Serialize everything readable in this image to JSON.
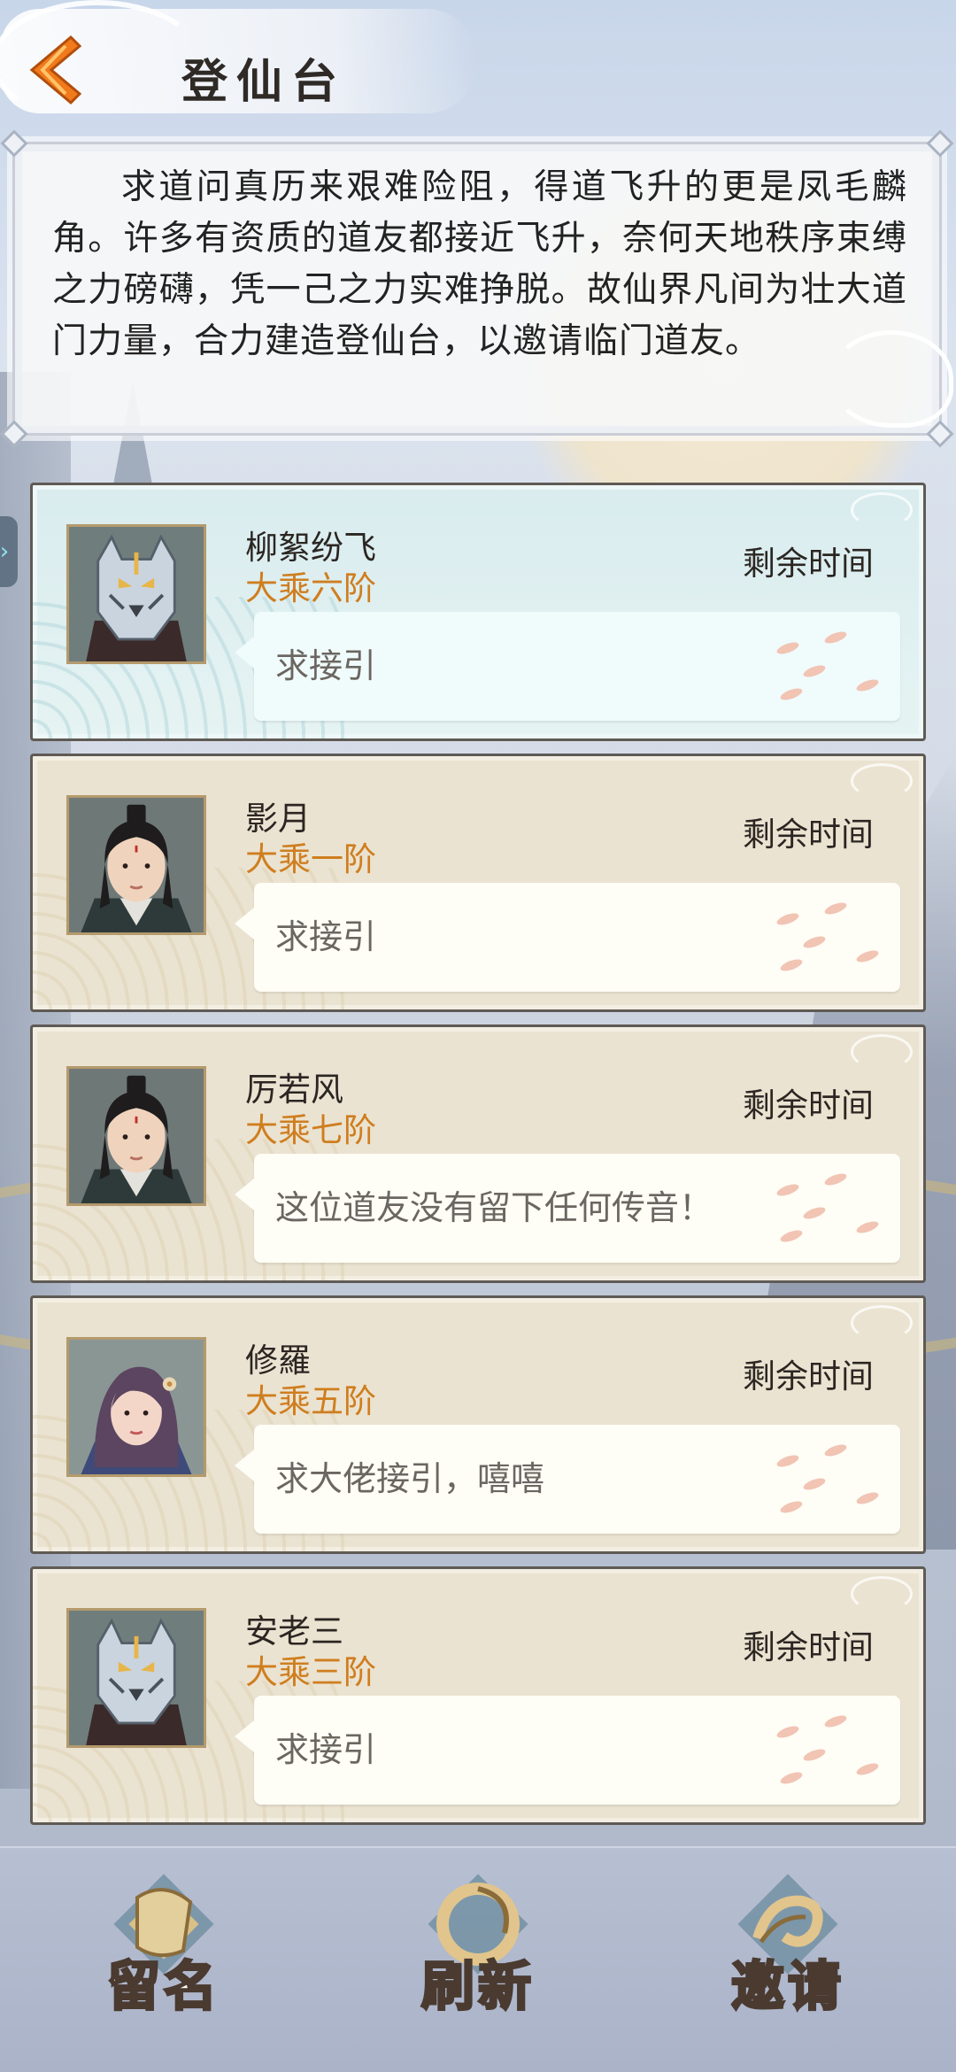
{
  "header": {
    "title": "登仙台"
  },
  "intro": {
    "text": "求道问真历来艰难险阻，得道飞升的更是凤毛麟角。许多有资质的道友都接近飞升，奈何天地秩序束缚之力磅礴，凭一己之力实难挣脱。故仙界凡间为壮大道门力量，合力建造登仙台，以邀请临门道友。"
  },
  "side_tab": {
    "glyph": "›"
  },
  "cards": [
    {
      "name": "柳絮纷飞",
      "rank": "大乘六阶",
      "remaining_label": "剩余时间",
      "message": "求接引",
      "avatar": "tiger-mask-avatar",
      "active": true
    },
    {
      "name": "影月",
      "rank": "大乘一阶",
      "remaining_label": "剩余时间",
      "message": "求接引",
      "avatar": "male-cultivator-avatar",
      "active": false
    },
    {
      "name": "厉若风",
      "rank": "大乘七阶",
      "remaining_label": "剩余时间",
      "message": "这位道友没有留下任何传音！",
      "avatar": "male-cultivator-avatar",
      "active": false
    },
    {
      "name": "修羅",
      "rank": "大乘五阶",
      "remaining_label": "剩余时间",
      "message": "求大佬接引，嘻嘻",
      "avatar": "female-cultivator-avatar",
      "active": false
    },
    {
      "name": "安老三",
      "rank": "大乘三阶",
      "remaining_label": "剩余时间",
      "message": "求接引",
      "avatar": "tiger-mask-avatar",
      "active": false
    }
  ],
  "actions": [
    {
      "label": "留名",
      "icon": "scroll-emblem-icon"
    },
    {
      "label": "刷新",
      "icon": "swirl-emblem-icon"
    },
    {
      "label": "邀请",
      "icon": "wave-emblem-icon"
    }
  ],
  "colors": {
    "rank": "#cf7e1f",
    "card_border": "#5f5a55",
    "active_card": "#d9ecee",
    "back_arrow": "#f07a1c"
  }
}
